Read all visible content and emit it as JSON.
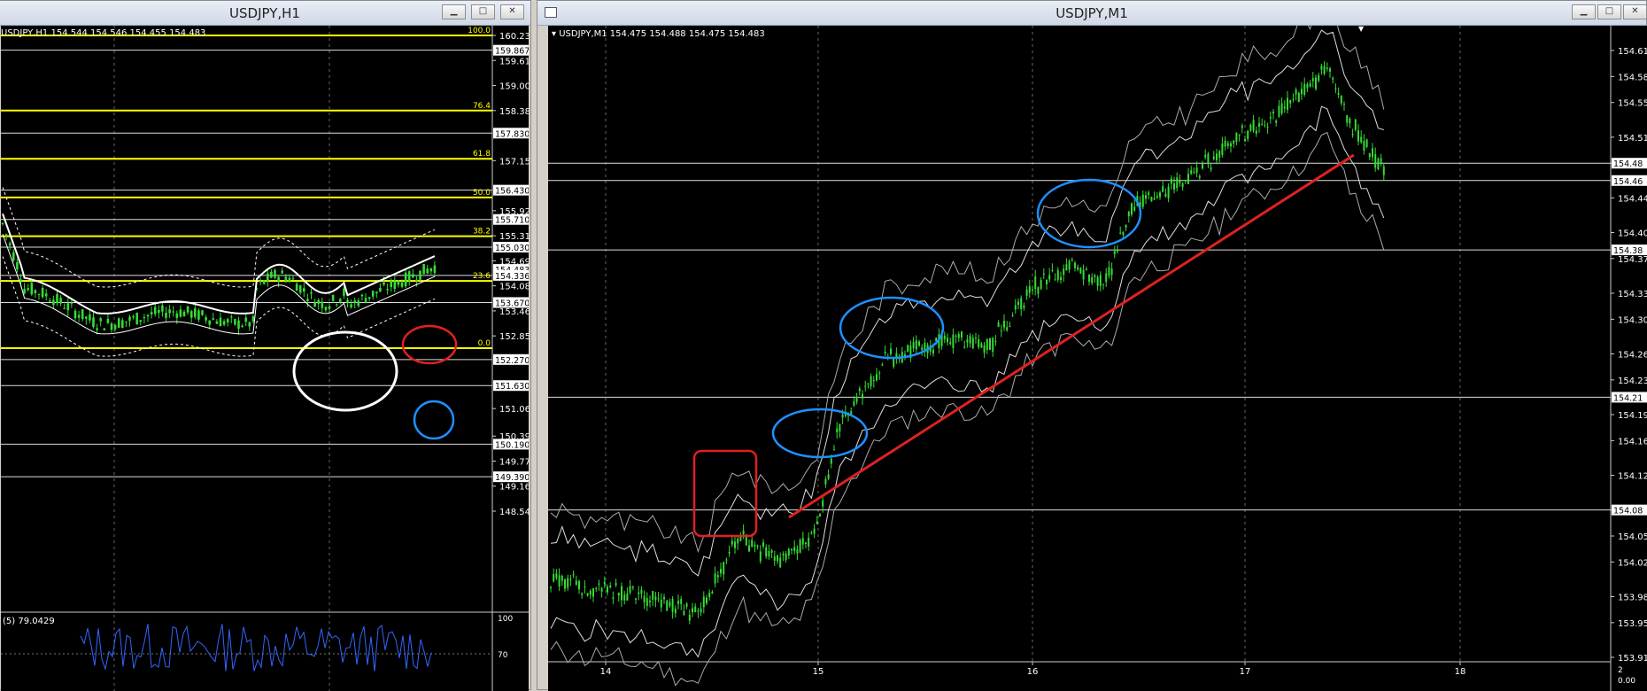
{
  "left": {
    "title": "USDJPY,H1",
    "header": "USDJPY,H1  154.544 154.546 154.455 154.483",
    "fib_levels": [
      {
        "label": "100.0",
        "price": 160.23
      },
      {
        "label": "76.4",
        "price": 158.385
      },
      {
        "label": "61.8",
        "price": 157.2
      },
      {
        "label": "50.0",
        "price": 156.25
      },
      {
        "label": "38.2",
        "price": 155.3
      },
      {
        "label": "23.6",
        "price": 154.2
      },
      {
        "label": "0.0",
        "price": 152.55
      }
    ],
    "white_levels": [
      159.867,
      157.83,
      156.43,
      155.71,
      155.03,
      154.336,
      153.67,
      152.27,
      151.63,
      150.19,
      149.39
    ],
    "price_ticks": [
      "160.230",
      "159.615",
      "159.000",
      "158.385",
      "157.155",
      "155.925",
      "155.310",
      "154.695",
      "154.080",
      "153.465",
      "152.850",
      "151.065",
      "150.390",
      "149.775",
      "149.160",
      "148.545"
    ],
    "price_tags": [
      "159.867",
      "157.830",
      "156.430",
      "155.710",
      "155.030",
      "154.483",
      "154.336",
      "153.670",
      "152.270",
      "151.630",
      "150.190",
      "149.390"
    ],
    "indicator_header": "(5) 79.0429",
    "indicator_ticks": [
      "100",
      "70"
    ]
  },
  "right": {
    "title": "USDJPY,M1",
    "header": "USDJPY,M1  154.475 154.488 154.475 154.483",
    "price_ticks": [
      "154.61",
      "154.58",
      "154.55",
      "154.51",
      "154.48",
      "154.44",
      "154.40",
      "154.37",
      "154.33",
      "154.30",
      "154.26",
      "154.23",
      "154.19",
      "154.16",
      "154.12",
      "154.08",
      "154.05",
      "154.02",
      "153.98",
      "153.95",
      "153.91"
    ],
    "price_tags": [
      "154.48",
      "154.46",
      "154.38",
      "154.21",
      "154.08"
    ],
    "x_ticks": [
      "14",
      "15",
      "16",
      "17",
      "18"
    ],
    "corner_labels": [
      "2",
      "0.00"
    ]
  },
  "colors": {
    "bull_candle": "#33dd33",
    "fib_line": "#ffff00",
    "trendline": "#dd2222",
    "highlight_blue": "#1e90ff",
    "highlight_red": "#e02020",
    "highlight_white": "#ffffff",
    "indicator_line": "#3366ff"
  },
  "icons": [
    "minimize-icon",
    "maximize-icon",
    "close-icon",
    "chart-window-icon"
  ]
}
